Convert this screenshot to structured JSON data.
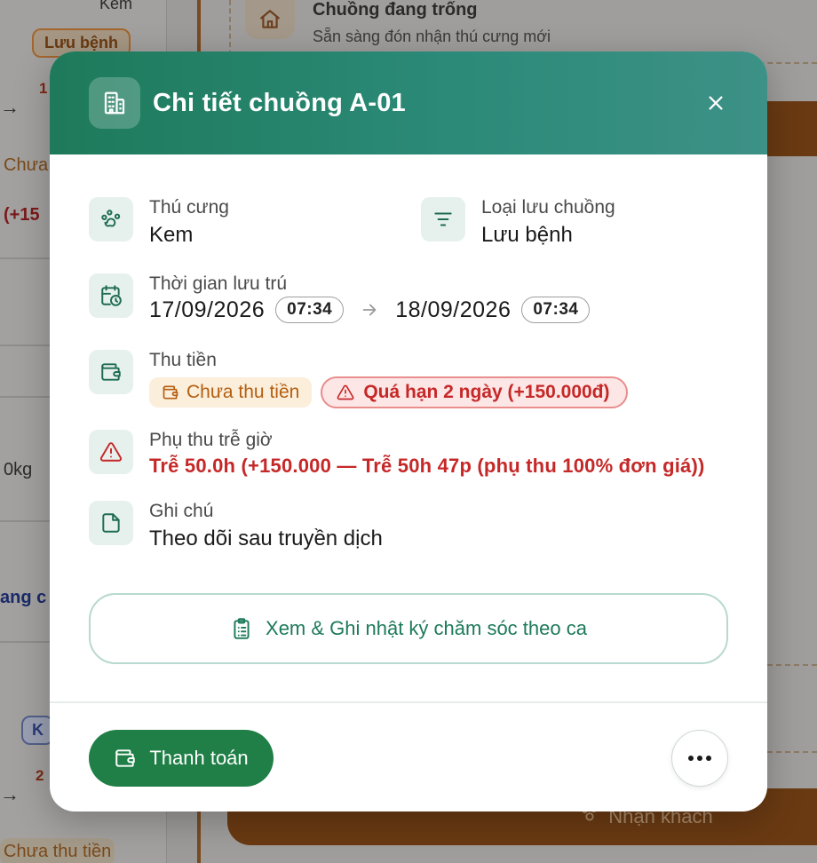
{
  "background": {
    "slot_title": "Chuồng đang trống",
    "slot_subtitle": "Sẵn sàng đón nhận thú cưng mới",
    "chip_luu_benh": "Lưu bệnh",
    "chip_k": "K",
    "chip_chua_thu_tien": "Chưa thu tiền",
    "frag_kem": "Kem",
    "frag_chua": "Chưa",
    "frag_plus15": "(+15",
    "frag_0kg": "0kg",
    "frag_dang": "ang c",
    "frag_1": "1",
    "frag_2": "2",
    "receive_button": "Nhận khách"
  },
  "modal": {
    "title": "Chi tiết chuồng A-01",
    "pet": {
      "label": "Thú cưng",
      "value": "Kem"
    },
    "stay_type": {
      "label": "Loại lưu chuồng",
      "value": "Lưu bệnh"
    },
    "stay_time": {
      "label": "Thời gian lưu trú",
      "start_date": "17/09/2026",
      "start_time": "07:34",
      "end_date": "18/09/2026",
      "end_time": "07:34"
    },
    "payment": {
      "label": "Thu tiền",
      "status": "Chưa thu tiền",
      "overdue": "Quá hạn 2 ngày (+150.000đ)"
    },
    "late_fee": {
      "label": "Phụ thu trễ giờ",
      "value": "Trễ 50.0h (+150.000 — Trễ 50h 47p (phụ thu 100% đơn giá))"
    },
    "note": {
      "label": "Ghi chú",
      "value": "Theo dõi sau truyền dịch"
    },
    "care_log_button": "Xem & Ghi nhật ký chăm sóc theo ca",
    "pay_button": "Thanh toán"
  },
  "colors": {
    "header_start": "#1e7a5a",
    "header_end": "#3d9186",
    "accent_green": "#1f7f46",
    "danger": "#c62828",
    "warning": "#b45e10"
  },
  "icons": [
    "building-icon",
    "close-icon",
    "paw-icon",
    "filter-icon",
    "calendar-clock-icon",
    "arrow-right-icon",
    "wallet-icon",
    "alert-triangle-icon",
    "file-icon",
    "clipboard-list-icon",
    "more-horizontal-icon",
    "home-icon"
  ]
}
